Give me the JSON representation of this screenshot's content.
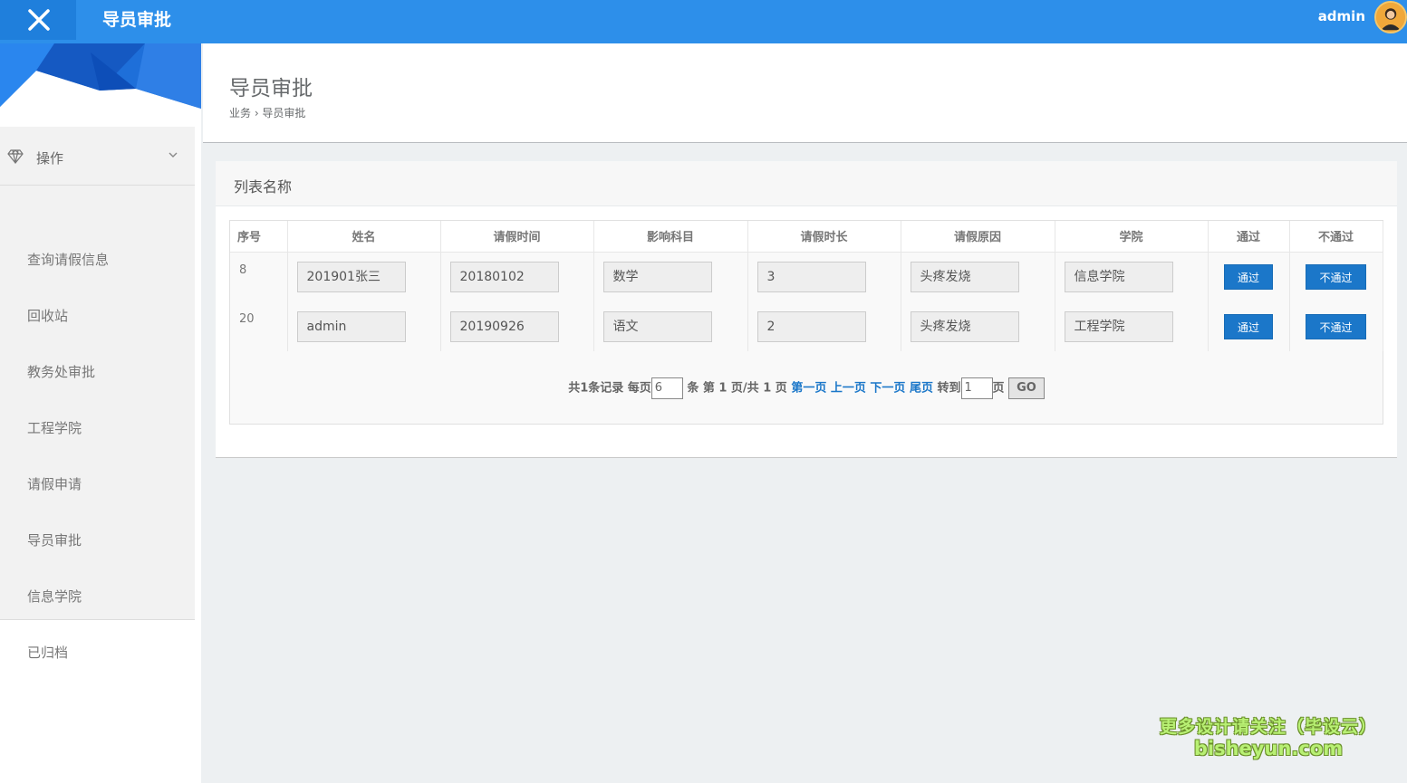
{
  "topbar": {
    "title": "导员审批",
    "user": "admin"
  },
  "sidebar": {
    "header": "操作",
    "items": [
      "查询请假信息",
      "回收站",
      "教务处审批",
      "工程学院",
      "请假申请",
      "导员审批",
      "信息学院",
      "已归档"
    ]
  },
  "page": {
    "title": "导员审批",
    "breadcrumb": "业务 › 导员审批"
  },
  "panel": {
    "title": "列表名称",
    "columns": [
      "序号",
      "姓名",
      "请假时间",
      "影响科目",
      "请假时长",
      "请假原因",
      "学院",
      "通过",
      "不通过"
    ],
    "rows": [
      {
        "idx": "8",
        "name": "201901张三",
        "time": "20180102",
        "subject": "数学",
        "duration": "3",
        "reason": "头疼发烧",
        "college": "信息学院",
        "approve": "通过",
        "reject": "不通过"
      },
      {
        "idx": "20",
        "name": "admin",
        "time": "20190926",
        "subject": "语文",
        "duration": "2",
        "reason": "头疼发烧",
        "college": "工程学院",
        "approve": "通过",
        "reject": "不通过"
      }
    ]
  },
  "pager": {
    "total_text": "共1条记录 每页",
    "per_page": "6",
    "page_info": "条 第 1 页/共 1 页",
    "first": "第一页",
    "prev": "上一页",
    "next": "下一页",
    "last": "尾页",
    "goto_label": "转到",
    "goto_value": "1",
    "page_suffix": "页",
    "go": "GO"
  },
  "watermark": {
    "line1": "更多设计请关注（毕设云）",
    "line2": "bisheyun.com"
  },
  "colors": {
    "topbar": "#2d8fea",
    "button": "#1b77c9"
  }
}
